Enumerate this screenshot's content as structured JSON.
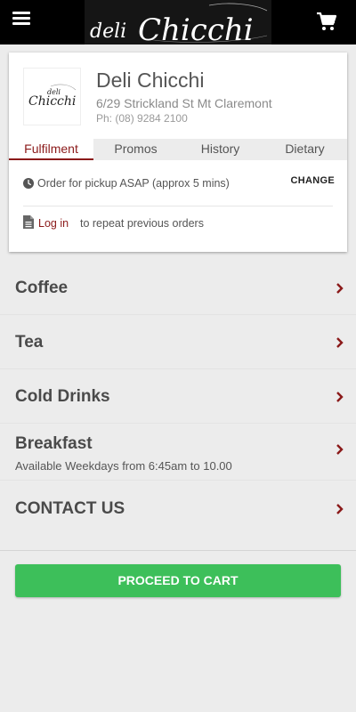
{
  "header": {
    "menu_icon": "hamburger-menu-icon",
    "logo_text_small": "deli",
    "logo_text_large": "Chicchi",
    "cart_icon": "shopping-cart-icon",
    "background": "#000000"
  },
  "store": {
    "logo_text_small": "deli",
    "logo_text_large": "Chicchi",
    "name": "Deli Chicchi",
    "address": "6/29 Strickland St Mt Claremont",
    "phone": "Ph: (08) 9284 2100"
  },
  "tabs": [
    {
      "label": "Fulfilment",
      "active": true
    },
    {
      "label": "Promos",
      "active": false
    },
    {
      "label": "History",
      "active": false
    },
    {
      "label": "Dietary",
      "active": false
    }
  ],
  "fulfilment": {
    "clock_icon": "clock-icon",
    "order_text": "Order for pickup ASAP (approx 5 mins)",
    "change_label": "CHANGE",
    "doc_icon": "document-icon",
    "login_link": "Log in",
    "login_rest": "to repeat previous orders"
  },
  "menu": [
    {
      "label": "Coffee",
      "sublabel": ""
    },
    {
      "label": "Tea",
      "sublabel": ""
    },
    {
      "label": "Cold Drinks",
      "sublabel": ""
    },
    {
      "label": "Breakfast",
      "sublabel": "Available Weekdays from 6:45am to 10.00"
    },
    {
      "label": "CONTACT US",
      "sublabel": ""
    }
  ],
  "cart": {
    "proceed_label": "PROCEED TO CART"
  },
  "colors": {
    "accent": "#8b1a1a",
    "proceed_button": "#3dbf5a",
    "page_background": "#ececec"
  }
}
